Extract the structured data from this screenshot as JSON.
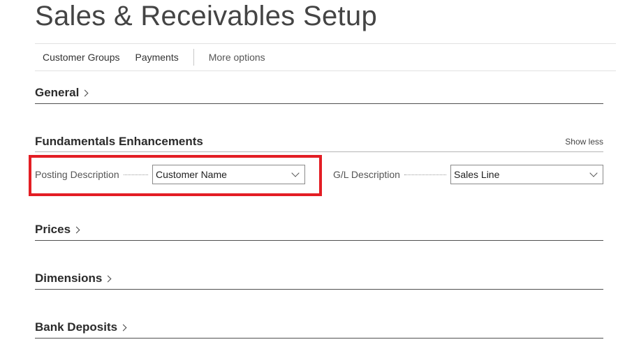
{
  "page": {
    "title": "Sales & Receivables Setup"
  },
  "action_bar": {
    "items": [
      "Customer Groups",
      "Payments"
    ],
    "more_options": "More options"
  },
  "sections": {
    "general": "General",
    "fundamentals": {
      "title": "Fundamentals Enhancements",
      "toggle_label": "Show less",
      "fields": [
        {
          "label": "Posting Description",
          "value": "Customer Name"
        },
        {
          "label": "G/L Description",
          "value": "Sales Line"
        }
      ]
    },
    "prices": "Prices",
    "dimensions": "Dimensions",
    "bank_deposits": "Bank Deposits"
  },
  "colors": {
    "highlight": "#e31e24"
  },
  "icons": {
    "expand": "chevron-right-icon",
    "dropdown": "chevron-down-icon"
  }
}
